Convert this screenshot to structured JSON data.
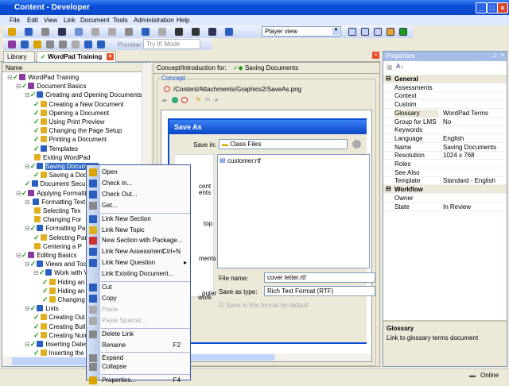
{
  "window": {
    "title": "Content - Developer"
  },
  "menu": [
    "File",
    "Edit",
    "View",
    "Link",
    "Document",
    "Tools",
    "Administration",
    "Help"
  ],
  "toolbar": {
    "view_select": "Player view",
    "preview_label": "Preview:",
    "preview_mode": "Try It! Mode"
  },
  "tabs": {
    "library": "Library",
    "active": "WordPad Training"
  },
  "tree": {
    "header": "Name",
    "items": [
      {
        "label": "WordPad Training",
        "level": 0,
        "check": true,
        "icon": "book"
      },
      {
        "label": "Document Basics",
        "level": 1,
        "check": true,
        "icon": "book"
      },
      {
        "label": "Creating and Opening Documents",
        "level": 2,
        "check": true,
        "icon": "section"
      },
      {
        "label": "Creating a New Document",
        "level": 3,
        "check": true,
        "icon": "topic"
      },
      {
        "label": "Opening a Document",
        "level": 3,
        "check": true,
        "icon": "topic"
      },
      {
        "label": "Using Print Preview",
        "level": 3,
        "check": true,
        "icon": "topic"
      },
      {
        "label": "Changing the Page Setup",
        "level": 3,
        "check": true,
        "icon": "topic"
      },
      {
        "label": "Printing a Document",
        "level": 3,
        "check": true,
        "icon": "topic"
      },
      {
        "label": "Templates",
        "level": 3,
        "check": true,
        "icon": "doc"
      },
      {
        "label": "Exiting WordPad",
        "level": 3,
        "check": false,
        "icon": "topic"
      },
      {
        "label": "Saving Documents",
        "level": 2,
        "check": true,
        "icon": "section",
        "selected": true
      },
      {
        "label": "Saving a Doc",
        "level": 3,
        "check": true,
        "icon": "topic"
      },
      {
        "label": "Document Securi",
        "level": 2,
        "check": true,
        "icon": "doc"
      },
      {
        "label": "Applying Formatting",
        "level": 1,
        "check": true,
        "icon": "book"
      },
      {
        "label": "Formatting Text",
        "level": 2,
        "check": false,
        "icon": "section"
      },
      {
        "label": "Selecting Tex",
        "level": 3,
        "check": false,
        "icon": "topic"
      },
      {
        "label": "Changing For",
        "level": 3,
        "check": false,
        "icon": "topic"
      },
      {
        "label": "Formatting Para",
        "level": 2,
        "check": true,
        "icon": "section"
      },
      {
        "label": "Selecting Par",
        "level": 3,
        "check": true,
        "icon": "topic"
      },
      {
        "label": "Centering a P",
        "level": 3,
        "check": false,
        "icon": "topic"
      },
      {
        "label": "Editing Basics",
        "level": 1,
        "check": true,
        "icon": "book"
      },
      {
        "label": "Views and Toolba",
        "level": 2,
        "check": true,
        "icon": "section"
      },
      {
        "label": "Work with Vie",
        "level": 3,
        "check": true,
        "icon": "section"
      },
      {
        "label": "Hiding an",
        "level": 4,
        "check": true,
        "icon": "topic"
      },
      {
        "label": "Hiding an",
        "level": 4,
        "check": true,
        "icon": "topic"
      },
      {
        "label": "Changing",
        "level": 4,
        "check": true,
        "icon": "topic"
      },
      {
        "label": "Lists",
        "level": 2,
        "check": true,
        "icon": "section"
      },
      {
        "label": "Creating Out",
        "level": 3,
        "check": true,
        "icon": "topic"
      },
      {
        "label": "Creating Bull",
        "level": 3,
        "check": true,
        "icon": "topic"
      },
      {
        "label": "Creating Num",
        "level": 3,
        "check": true,
        "icon": "topic"
      },
      {
        "label": "Inserting Dates",
        "level": 2,
        "check": true,
        "icon": "section"
      },
      {
        "label": "Inserting the",
        "level": 3,
        "check": true,
        "icon": "topic"
      }
    ]
  },
  "concept": {
    "header_label": "Concept/Introduction for:",
    "header_doc": "Saving Documents",
    "group": "Concept",
    "path": "/Content/Attachments/Graphics2/SaveAs.png"
  },
  "saveas": {
    "title": "Save As",
    "save_in_label": "Save in:",
    "save_in_value": "Class Files",
    "file": "customer.rtf",
    "places": [
      "cent",
      "ents",
      "top",
      "ments",
      "puter",
      "work"
    ],
    "file_name_label": "File name:",
    "file_name_value": "cover letter.rtf",
    "type_label": "Save as type:",
    "type_value": "Rich Text Format (RTF)",
    "default_check": "Save in this format by default"
  },
  "context_menu": [
    {
      "label": "Open"
    },
    {
      "label": "Check In..."
    },
    {
      "label": "Check Out..."
    },
    {
      "label": "Get..."
    },
    {
      "sep": true
    },
    {
      "label": "Link New Section"
    },
    {
      "label": "Link New Topic"
    },
    {
      "label": "New Section with Package..."
    },
    {
      "label": "Link New Assessment",
      "shortcut": "Ctrl+N"
    },
    {
      "label": "Link New Question",
      "submenu": true
    },
    {
      "label": "Link Existing Document..."
    },
    {
      "sep": true
    },
    {
      "label": "Cut"
    },
    {
      "label": "Copy"
    },
    {
      "label": "Paste",
      "disabled": true
    },
    {
      "label": "Paste Special...",
      "disabled": true
    },
    {
      "sep": true
    },
    {
      "label": "Delete Link"
    },
    {
      "label": "Rename",
      "shortcut": "F2"
    },
    {
      "sep": true
    },
    {
      "label": "Expand"
    },
    {
      "label": "Collapse"
    },
    {
      "sep": true
    },
    {
      "label": "Properties...",
      "shortcut": "F4"
    }
  ],
  "properties": {
    "title": "Properties",
    "rows": [
      {
        "cat": "General"
      },
      {
        "k": "Assessments",
        "v": ""
      },
      {
        "k": "Context",
        "v": ""
      },
      {
        "k": "Custom prope...",
        "v": ""
      },
      {
        "k": "Glossary",
        "v": "WordPad Terms"
      },
      {
        "k": "Group for LMS",
        "v": "No"
      },
      {
        "k": "Keywords",
        "v": ""
      },
      {
        "k": "Language",
        "v": "English"
      },
      {
        "k": "Name",
        "v": "Saving Documents"
      },
      {
        "k": "Resolution",
        "v": "1024 x 768"
      },
      {
        "k": "Roles",
        "v": ""
      },
      {
        "k": "See Also",
        "v": ""
      },
      {
        "k": "Template",
        "v": "Standard - English"
      },
      {
        "cat": "Workflow"
      },
      {
        "k": "Owner",
        "v": ""
      },
      {
        "k": "State",
        "v": "In Review"
      }
    ],
    "desc_title": "Glossary",
    "desc_text": "Link to glossary terms document"
  },
  "status": {
    "online": "Online"
  }
}
